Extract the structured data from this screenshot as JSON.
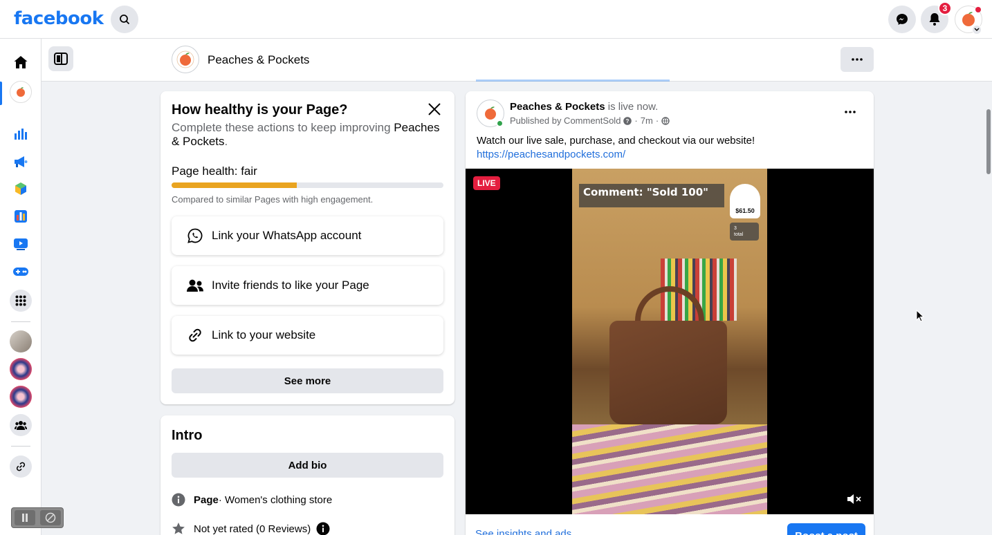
{
  "brand": {
    "logo": "facebook"
  },
  "topbar": {
    "notification_count": "3"
  },
  "page": {
    "name": "Peaches & Pockets"
  },
  "health": {
    "title": "How healthy is your Page?",
    "subtitle_prefix": "Complete these actions to keep improving ",
    "subtitle_page": "Peaches & Pockets",
    "subtitle_suffix": ".",
    "status_label": "Page health: fair",
    "progress": 0.46,
    "note": "Compared to similar Pages with high engagement.",
    "actions": [
      {
        "label": "Link your WhatsApp account",
        "icon": "whatsapp-icon"
      },
      {
        "label": "Invite friends to like your Page",
        "icon": "friends-icon"
      },
      {
        "label": "Link to your website",
        "icon": "link-icon"
      }
    ],
    "see_more": "See more"
  },
  "intro": {
    "title": "Intro",
    "add_bio": "Add bio",
    "category_label": "Page",
    "category_value": " · Women's clothing store",
    "rating": "Not yet rated (0 Reviews)"
  },
  "post": {
    "page_name": "Peaches & Pockets",
    "state": " is live now.",
    "published_by": "Published by CommentSold",
    "time": "7m",
    "text": "Watch our live sale, purchase, and checkout via our website!",
    "link": "https://peachesandpockets.com/",
    "live_badge": "LIVE",
    "comment_banner": "Comment: \"Sold 100\"",
    "price": "$61.50",
    "viewer_count": "3",
    "viewer_label": "total",
    "footer_link": "See insights and ads",
    "boost_button": "Boost a post"
  },
  "colors": {
    "accent": "#1877f2",
    "live": "#e41e3f",
    "health_bar": "#e9a420"
  }
}
